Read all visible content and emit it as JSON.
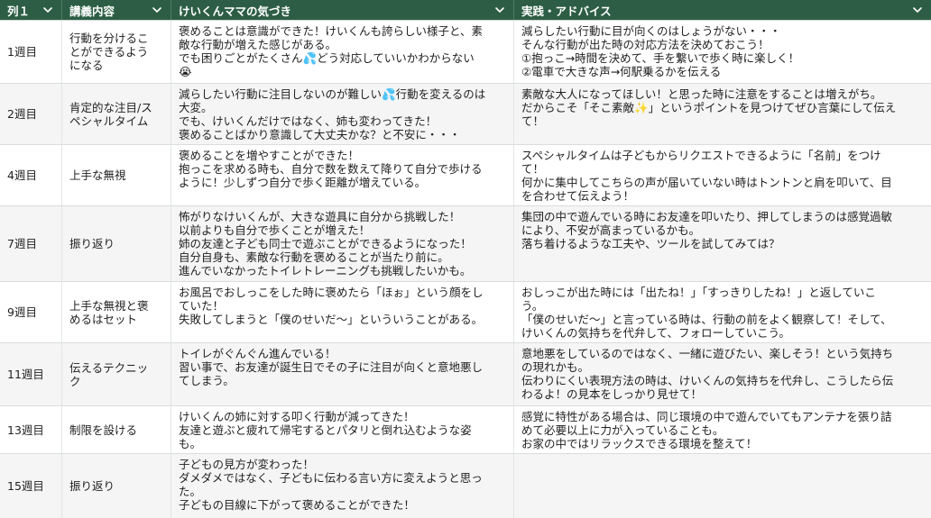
{
  "header": {
    "col1": "列１",
    "col2": "講義内容",
    "col3": "けいくんママの気づき",
    "col4": "実践・アドバイス"
  },
  "rows": [
    {
      "week": "1週目",
      "topic": "行動を分けるこ\nとができるよう\nになる",
      "notice": "褒めることは意識ができた！けいくんも誇らしい様子と、素\n敵な行動が増えた感じがある。\nでも困りごとがたくさん💦どう対応していいかわからない\n😭",
      "advice": "減らしたい行動に目が向くのはしょうがない・・・\nそんな行動が出た時の対応方法を決めておこう！\n①抱っこ→時間を決めて、手を繋いで歩く時に楽しく！\n②電車で大きな声→何駅乗るかを伝える"
    },
    {
      "week": "2週目",
      "topic": "肯定的な注目/ス\nペシャルタイム",
      "notice": "減らしたい行動に注目しないのが難しい💦行動を変えるのは\n大変。\nでも、けいくんだけではなく、姉も変わってきた！\n褒めることばかり意識して大丈夫かな？と不安に・・・",
      "advice": "素敵な大人になってほしい！と思った時に注意をすることは増えがち。\nだからこそ「そこ素敵✨」というポイントを見つけてぜひ言葉にして伝え\nて！"
    },
    {
      "week": "4週目",
      "topic": "上手な無視",
      "notice": "褒めることを増やすことができた！\n抱っこを求める時も、自分で数を数えて降りて自分で歩ける\nように！少しずつ自分で歩く距離が増えている。",
      "advice": "スペシャルタイムは子どもからリクエストできるように「名前」をつけ\nて！\n何かに集中してこちらの声が届いていない時はトントンと肩を叩いて、目\nを合わせて伝えよう！"
    },
    {
      "week": "7週目",
      "topic": "振り返り",
      "notice": "怖がりなけいくんが、大きな遊具に自分から挑戦した！\n以前よりも自分で歩くことが増えた！\n姉の友達と子ども同士で遊ぶことができるようになった！\n自分自身も、素敵な行動を褒めることが当たり前に。\n進んでいなかったトイレトレーニングも挑戦したいかも。",
      "advice": "集団の中で遊んでいる時にお友達を叩いたり、押してしまうのは感覚過敏\nにより、不安が高まっているかも。\n落ち着けるような工夫や、ツールを試してみては？"
    },
    {
      "week": "9週目",
      "topic": "上手な無視と褒\nめるはセット",
      "notice": "お風呂でおしっこをした時に褒めたら「ほぉ」という顔をし\nていた！\n失敗してしまうと「僕のせいだ〜」といういうことがある。",
      "advice": "おしっこが出た時には「出たね！」「すっきりしたね！」と返していこ\nう。\n「僕のせいだ〜」と言っている時は、行動の前をよく観察して！そして、\nけいくんの気持ちを代弁して、フォローしていこう。"
    },
    {
      "week": "11週目",
      "topic": "伝えるテクニッ\nク",
      "notice": "トイレがぐんぐん進んでいる！\n習い事で、お友達が誕生日でその子に注目が向くと意地悪し\nてしまう。",
      "advice": "意地悪をしているのではなく、一緒に遊びたい、楽しそう！という気持ち\nの現れかも。\n伝わりにくい表現方法の時は、けいくんの気持ちを代弁し、こうしたら伝\nわるよ！の見本をしっかり見せて！"
    },
    {
      "week": "13週目",
      "topic": "制限を設ける",
      "notice": "けいくんの姉に対する叩く行動が減ってきた！\n友達と遊ぶと疲れて帰宅するとパタリと倒れ込むような姿\nも。",
      "advice": "感覚に特性がある場合は、同じ環境の中で遊んでいてもアンテナを張り詰\nめて必要以上に力が入っていることも。\nお家の中ではリラックスできる環境を整えて！"
    },
    {
      "week": "15週目",
      "topic": "振り返り",
      "notice": "子どもの見方が変わった！\nダメダメではなく、子どもに伝わる言い方に変えようと思っ\nた。\n子どもの目線に下がって褒めることができた！",
      "advice": ""
    }
  ],
  "colors": {
    "header_bg": "#2d5e45",
    "header_text": "#ffffff",
    "row_alt_bg": "#f4f5f4"
  }
}
